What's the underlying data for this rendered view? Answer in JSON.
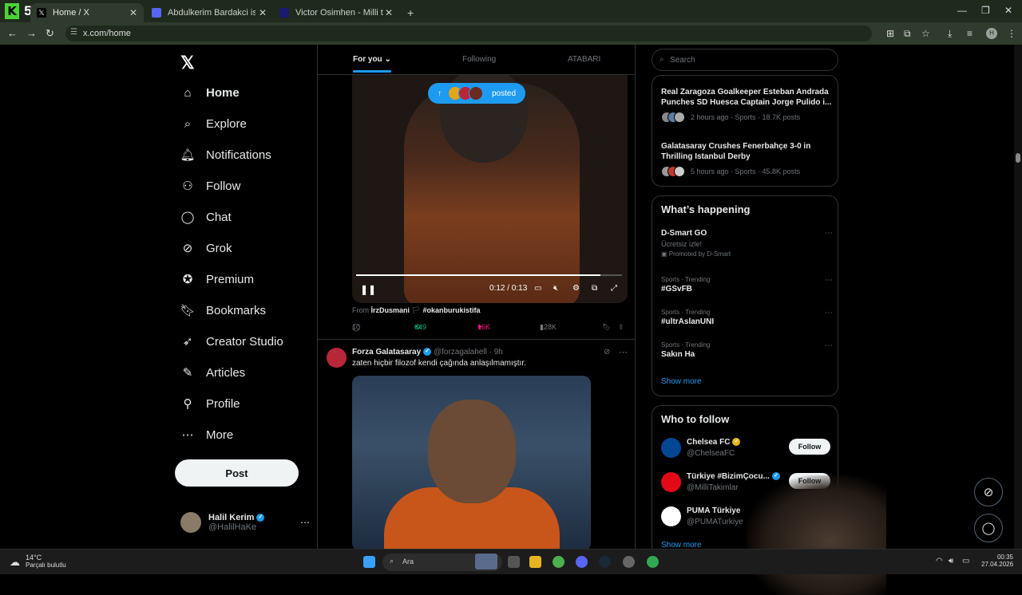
{
  "browser": {
    "tabs": [
      {
        "title": "Home / X",
        "active": true
      },
      {
        "title": "Abdulkerim Bardakci istatistikle",
        "active": false
      },
      {
        "title": "Victor Osimhen - Milli takım | T",
        "active": false
      }
    ],
    "url": "x.com/home",
    "profile_initial": "H"
  },
  "sidebar": {
    "items": [
      {
        "label": "Home",
        "icon": "home-icon"
      },
      {
        "label": "Explore",
        "icon": "search-icon"
      },
      {
        "label": "Notifications",
        "icon": "bell-icon"
      },
      {
        "label": "Follow",
        "icon": "add-person-icon"
      },
      {
        "label": "Chat",
        "icon": "chat-icon"
      },
      {
        "label": "Grok",
        "icon": "grok-icon"
      },
      {
        "label": "Premium",
        "icon": "premium-icon"
      },
      {
        "label": "Bookmarks",
        "icon": "bookmark-icon"
      },
      {
        "label": "Creator Studio",
        "icon": "rocket-icon"
      },
      {
        "label": "Articles",
        "icon": "article-icon"
      },
      {
        "label": "Profile",
        "icon": "person-icon"
      },
      {
        "label": "More",
        "icon": "more-icon"
      }
    ],
    "post_label": "Post",
    "user": {
      "name": "Halil Kerim",
      "handle": "@HalilHaKe"
    }
  },
  "feed": {
    "tabs": [
      "For you",
      "Following",
      "ATABARI"
    ],
    "toast": "posted",
    "video": {
      "time": "0:12 / 0:13",
      "progress": 0.92
    },
    "from_label": "From",
    "from_user": "İrzDusmani",
    "from_tag": "#okanburukistifa",
    "actions": {
      "replies": "10",
      "reposts": "649",
      "likes": "16K",
      "views": "128K"
    },
    "post2": {
      "name": "Forza Galatasaray",
      "handle": "@forzagalahell · 9h",
      "text": "zaten hiçbir filozof kendi çağında anlaşılmamıştır."
    }
  },
  "right": {
    "search_placeholder": "Search",
    "news": [
      {
        "title": "Real Zaragoza Goalkeeper Esteban Andrada Punches SD Huesca Captain Jorge Pulido i...",
        "meta": "2 hours ago · Sports · 18.7K posts"
      },
      {
        "title": "Galatasaray Crushes Fenerbahçe 3-0 in Thrilling Istanbul Derby",
        "meta": "5 hours ago · Sports · 45.8K posts"
      }
    ],
    "happening_title": "What’s happening",
    "promo": {
      "name": "D-Smart GO",
      "sub": "Ücretsiz izle!",
      "promoted": "Promoted by D-Smart"
    },
    "trends": [
      {
        "category": "Sports · Trending",
        "name": "#GSvFB"
      },
      {
        "category": "Sports · Trending",
        "name": "#ultrAslanUNI"
      },
      {
        "category": "Sports · Trending",
        "name": "Sakın Ha"
      }
    ],
    "show_more": "Show more",
    "wtf_title": "Who to follow",
    "follow_label": "Follow",
    "wtf": [
      {
        "name": "Chelsea FC",
        "handle": "@ChelseaFC",
        "color": "#034694"
      },
      {
        "name": "Türkiye #BizimÇocu...",
        "handle": "@MilliTakimlar",
        "color": "#e30a17"
      },
      {
        "name": "PUMA Türkiye",
        "handle": "@PUMATurkiye",
        "color": "#ffffff"
      }
    ],
    "show_more_2": "Show more"
  },
  "taskbar": {
    "temp": "14°C",
    "weather": "Parçalı bulutlu",
    "search": "Ara",
    "time": "00:35",
    "date": "27.04.2026"
  },
  "colors": {
    "accent": "#1d9bf0",
    "like": "#f91880",
    "repost": "#00ba7c"
  }
}
